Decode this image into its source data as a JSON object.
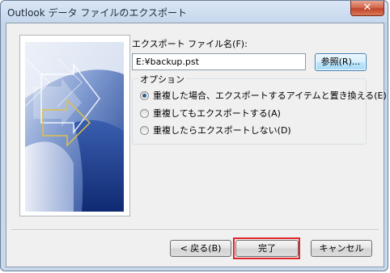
{
  "window": {
    "title": "Outlook データ ファイルのエクスポート",
    "close_label": "✕"
  },
  "file": {
    "label": "エクスポート ファイル名(F):",
    "value": "E:¥backup.pst",
    "browse_label": "参照(R)..."
  },
  "options": {
    "legend": "オプション",
    "items": [
      {
        "label": "重複した場合、エクスポートするアイテムと置き換える(E)",
        "selected": true
      },
      {
        "label": "重複してもエクスポートする(A)",
        "selected": false
      },
      {
        "label": "重複したらエクスポートしない(D)",
        "selected": false
      }
    ]
  },
  "footer": {
    "back_label": "< 戻る(B)",
    "finish_label": "完了",
    "cancel_label": "キャンセル"
  },
  "colors": {
    "highlight": "#e0262b",
    "art_dark": "#1f3f8f",
    "art_light": "#dfe7f4",
    "arrow": "#e0c04a"
  }
}
